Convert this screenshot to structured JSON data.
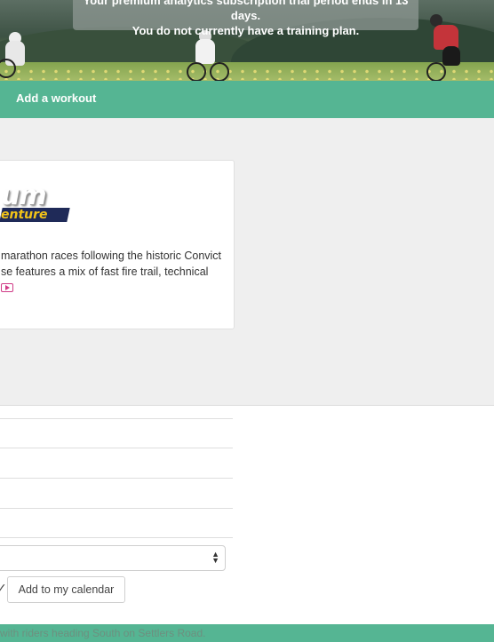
{
  "banner": {
    "notice_line1": "Your premium analytics subscription trial period ends in 13 days.",
    "notice_line2": "You do not currently have a training plan."
  },
  "nav": {
    "add_workout": "Add a workout"
  },
  "event_card": {
    "logo_top": "um",
    "logo_bottom": "enture",
    "desc_line1": "marathon races following the historic Convict",
    "desc_line2": "se features a mix of fast fire trail, technical",
    "video_icon": "video-play-icon",
    "video_color": "#d03a86"
  },
  "form": {
    "select_value": "",
    "check_mark": "✓",
    "add_calendar": "Add to my calendar"
  },
  "footer": {
    "caption": "with riders heading South on Settlers Road."
  },
  "colors": {
    "accent": "#55b593",
    "background_grey": "#efefef"
  }
}
